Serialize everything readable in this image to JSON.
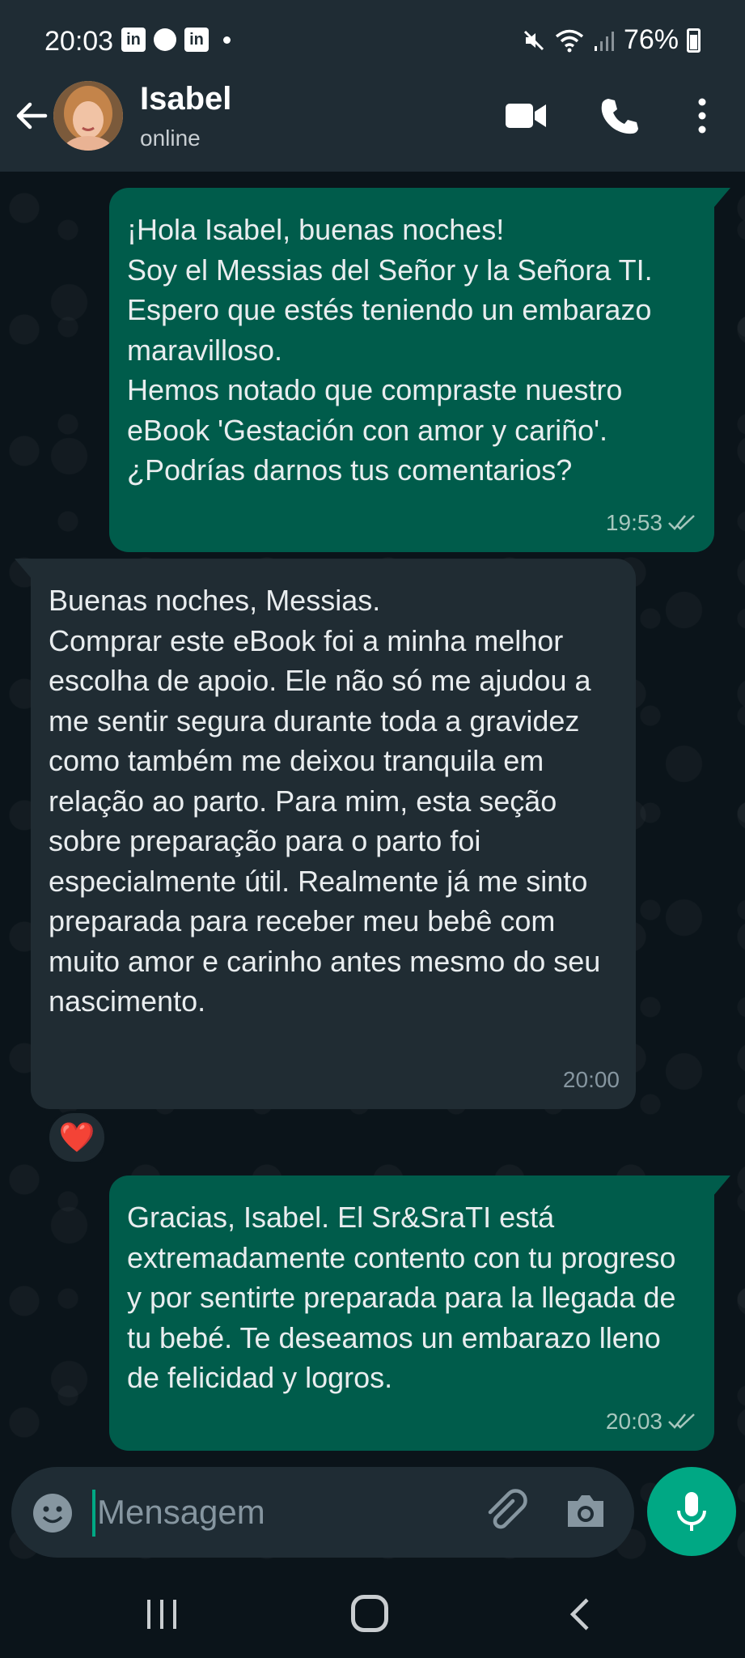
{
  "status_bar": {
    "time": "20:03",
    "left_icons": [
      "linkedin-icon",
      "app-icon",
      "linkedin-icon",
      "dot-icon"
    ],
    "right_icons": [
      "mute-icon",
      "wifi-icon",
      "signal-icon",
      "battery-icon"
    ],
    "battery_percent": "76%"
  },
  "header": {
    "contact_name": "Isabel",
    "contact_status": "online",
    "icons": [
      "back-arrow-icon",
      "video-call-icon",
      "phone-icon",
      "more-vertical-icon"
    ]
  },
  "messages": [
    {
      "direction": "outgoing",
      "text": "¡Hola Isabel, buenas noches!\nSoy el Messias del Señor y la Señora TI. Espero que estés teniendo un embarazo maravilloso.\nHemos notado que compraste nuestro eBook 'Gestación con amor y cariño'. ¿Podrías darnos tus comentarios?",
      "time": "19:53",
      "status": "read"
    },
    {
      "direction": "incoming",
      "text": "Buenas noches, Messias.\nComprar este eBook foi a minha melhor escolha de apoio. Ele não só me ajudou a me sentir segura durante toda a gravidez como também me deixou tranquila em relação ao parto. Para mim, esta seção sobre preparação para o parto foi especialmente útil. Realmente já me sinto preparada para receber meu bebê com muito amor e carinho antes mesmo do seu nascimento.",
      "time": "20:00",
      "reaction": "❤️"
    },
    {
      "direction": "outgoing",
      "text": "Gracias, Isabel. El Sr&SraTI está extremadamente contento con tu progreso y por sentirte preparada para la llegada de tu bebé. Te deseamos un embarazo lleno de felicidad y logros.",
      "time": "20:03",
      "status": "read"
    }
  ],
  "input": {
    "placeholder": "Mensagem",
    "value": ""
  },
  "colors": {
    "background": "#0b141a",
    "header": "#1f2c34",
    "outgoing_bubble": "#005c4b",
    "incoming_bubble": "#202c33",
    "accent": "#00a884",
    "reaction_heart": "#f2344a"
  }
}
